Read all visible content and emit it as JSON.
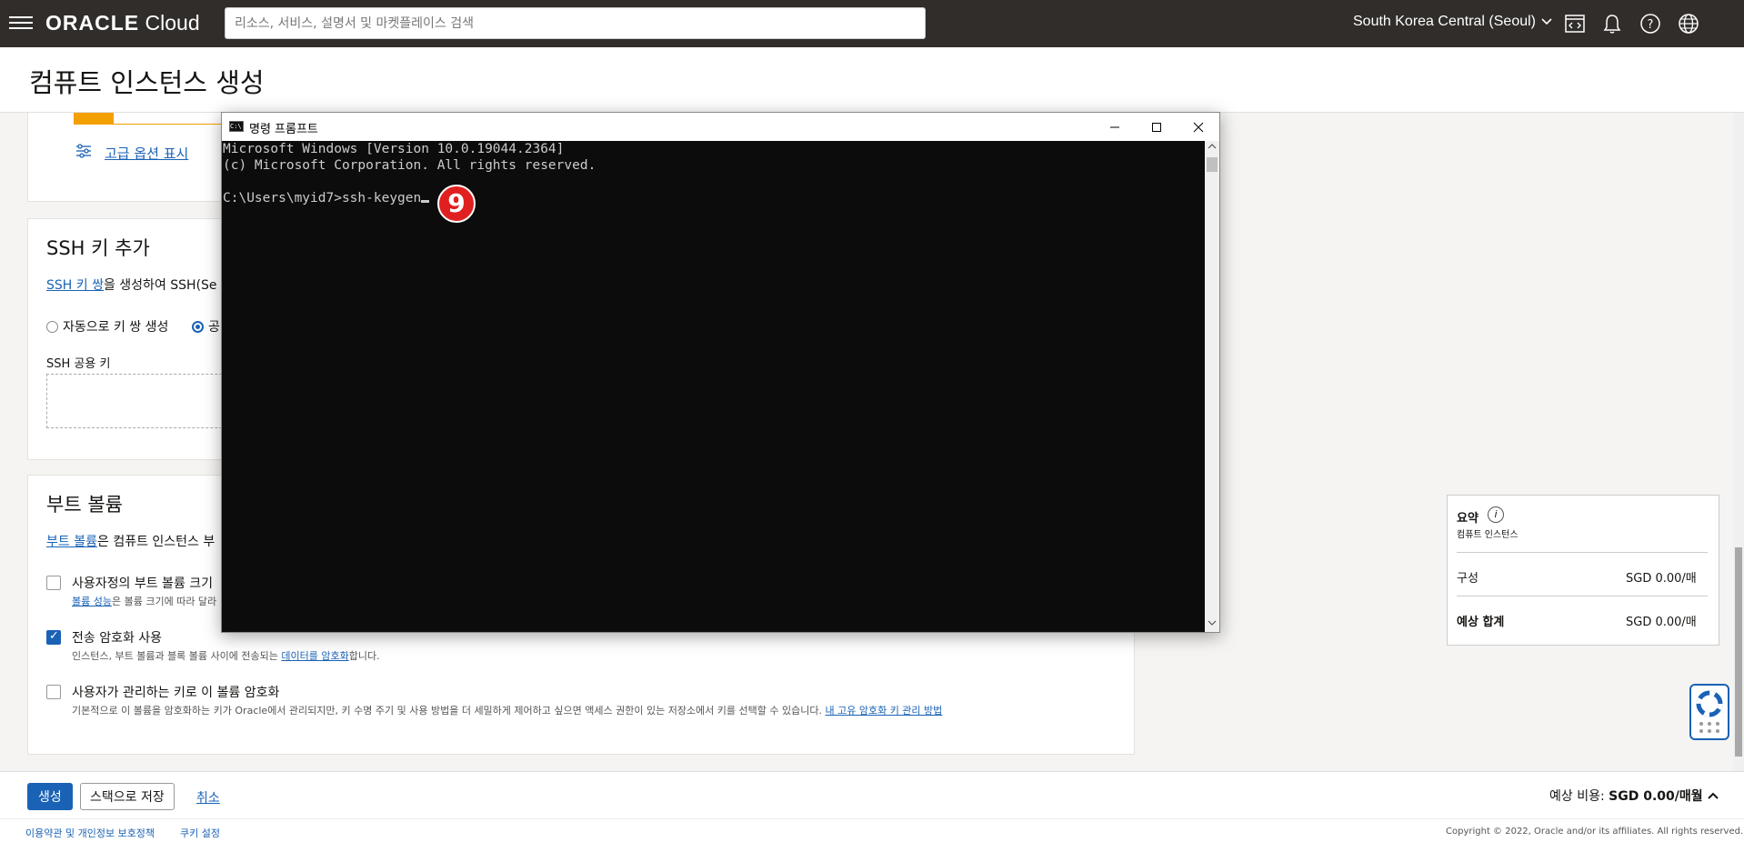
{
  "topbar": {
    "logo_bold": "ORACLE",
    "logo_light": "Cloud",
    "search_placeholder": "리소스, 서비스, 설명서 및 마켓플레이스 검색",
    "region": "South Korea Central (Seoul)",
    "icons": [
      "menu-icon",
      "code-editor-icon",
      "bell-icon",
      "help-icon",
      "globe-icon"
    ]
  },
  "page": {
    "title": "컴퓨트 인스턴스 생성"
  },
  "advanced": {
    "link": "고급 옵션 표시"
  },
  "ssh": {
    "title": "SSH 키 추가",
    "desc_link": "SSH 키 쌍",
    "desc_rest": "을 생성하여 SSH(Se",
    "radio_auto": "자동으로 키 쌍 생성",
    "radio_public": "공",
    "field_label": "SSH 공용 키"
  },
  "boot": {
    "title": "부트 볼륨",
    "desc_link": "부트 볼륨",
    "desc_rest": "은 컴퓨트 인스턴스 부",
    "opt1_label": "사용자정의 부트 볼륨 크기",
    "opt1_help_link": "볼륨 성능",
    "opt1_help_rest": "은 볼륨 크기에 따라 달라",
    "opt2_label": "전송 암호화 사용",
    "opt2_help_pre": "인스턴스, 부트 볼륨과 블록 볼륨 사이에 전송되는 ",
    "opt2_help_link": "데이터를 암호화",
    "opt2_help_post": "합니다.",
    "opt3_label": "사용자가 관리하는 키로 이 볼륨 암호화",
    "opt3_help_pre": "기본적으로 이 볼륨을 암호화하는 키가 Oracle에서 관리되지만, 키 수명 주기 및 사용 방법을 더 세밀하게 제어하고 싶으면 액세스 권한이 있는 저장소에서 키를 선택할 수 있습니다. ",
    "opt3_help_link": "내 고유 암호화 키 관리 방법"
  },
  "summary": {
    "title": "요약",
    "subtitle": "컴퓨트 인스턴스",
    "row1_label": "구성",
    "row1_value": "SGD 0.00/매",
    "row2_label": "예상 합계",
    "row2_value": "SGD 0.00/매"
  },
  "actions": {
    "create": "생성",
    "save_stack": "스택으로 저장",
    "cancel": "취소",
    "est_label": "예상 비용:",
    "est_value": "SGD 0.00/매월"
  },
  "footer": {
    "terms": "이용약관 및 개인정보 보호정책",
    "cookies": "쿠키 설정",
    "copyright": "Copyright © 2022, Oracle and/or its affiliates. All rights reserved."
  },
  "cmd": {
    "title": "명령 프롬프트",
    "lines": [
      "Microsoft Windows [Version 10.0.19044.2364]",
      "(c) Microsoft Corporation. All rights reserved.",
      "",
      "C:\\Users\\myid7>ssh-keygen"
    ],
    "step_badge": "9"
  },
  "colors": {
    "topbar_bg": "#312d2a",
    "link": "#1a62b5",
    "primary": "#1a62b5",
    "badge": "#e02020",
    "progress": "#f3a000"
  }
}
